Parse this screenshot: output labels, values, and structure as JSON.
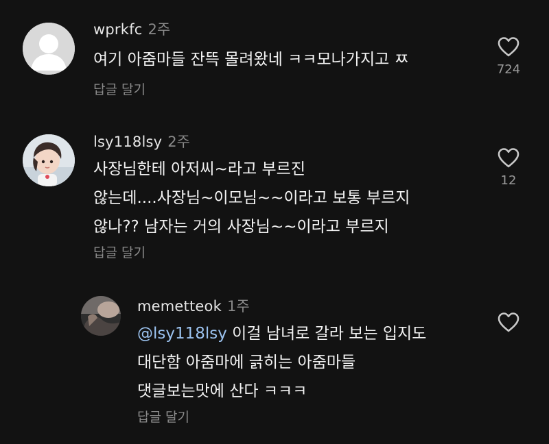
{
  "comments": [
    {
      "username": "wprkfc",
      "time": "2주",
      "lines": [
        "여기 아줌마들 잔뜩 몰려왔네 ㅋㅋ모나가지고 ㅉ"
      ],
      "reply_label": "답글 달기",
      "like_count": "724",
      "avatar": "default-profile-avatar"
    },
    {
      "username": "lsy118lsy",
      "time": "2주",
      "lines": [
        "사장님한테 아저씨~라고 부르진",
        "않는데....사장님~이모님~~이라고 보통 부르지",
        "않나?? 남자는 거의 사장님~~이라고 부르지"
      ],
      "reply_label": "답글 달기",
      "like_count": "12",
      "avatar": "child-photo-avatar"
    }
  ],
  "reply": {
    "username": "memetteok",
    "time": "1주",
    "mention": "@lsy118lsy",
    "first_line_rest": " 이걸 남녀로 갈라 보는 입지도",
    "lines": [
      "대단함 아줌마에 긁히는 아줌마들",
      "댓글보는맛에 산다 ㅋㅋㅋ"
    ],
    "reply_label": "답글 달기",
    "avatar": "photo-avatar"
  },
  "colors": {
    "background": "#121212",
    "text": "#f2f2f2",
    "muted": "#8c8c8c",
    "mention": "#9cc3f0"
  }
}
